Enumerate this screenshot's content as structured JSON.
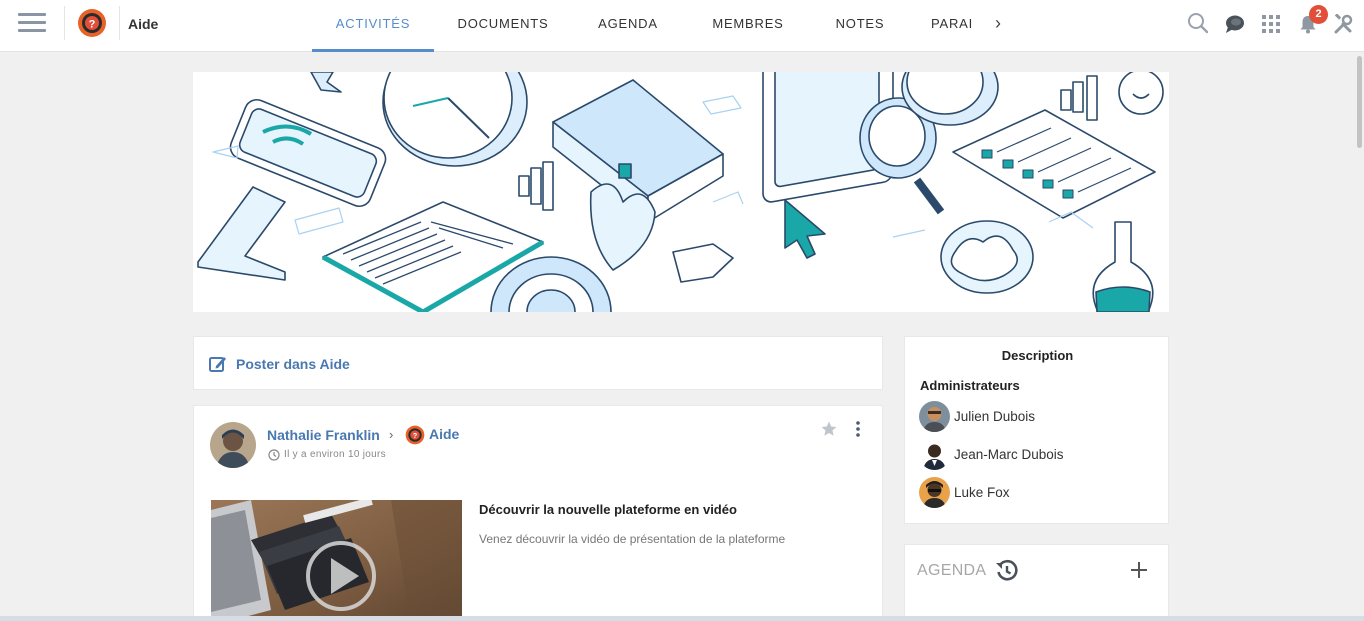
{
  "header": {
    "space_name": "Aide",
    "tabs": [
      {
        "label": "ACTIVITÉS",
        "active": true
      },
      {
        "label": "DOCUMENTS",
        "active": false
      },
      {
        "label": "AGENDA",
        "active": false
      },
      {
        "label": "MEMBRES",
        "active": false
      },
      {
        "label": "NOTES",
        "active": false
      },
      {
        "label": "PARAI",
        "active": false
      }
    ],
    "notification_count": "2",
    "accent_color": "#578dc9"
  },
  "composer": {
    "label": "Poster dans Aide"
  },
  "activity": {
    "author": "Nathalie Franklin",
    "space": "Aide",
    "time": "Il y a environ 10 jours",
    "link_title": "Découvrir la nouvelle plateforme en vidéo",
    "link_description": "Venez découvrir la vidéo de présentation de la plateforme"
  },
  "description_panel": {
    "title": "Description",
    "admins_title": "Administrateurs",
    "admins": [
      {
        "name": "Julien Dubois"
      },
      {
        "name": "Jean-Marc Dubois"
      },
      {
        "name": "Luke Fox"
      }
    ]
  },
  "agenda_panel": {
    "title": "AGENDA"
  },
  "icons": [
    "menu-icon",
    "help-icon",
    "chevron-right-icon",
    "search-icon",
    "chat-icon",
    "apps-icon",
    "bell-icon",
    "tools-icon",
    "edit-icon",
    "clock-icon",
    "star-icon",
    "more-vertical-icon",
    "play-icon",
    "history-icon",
    "plus-icon"
  ]
}
